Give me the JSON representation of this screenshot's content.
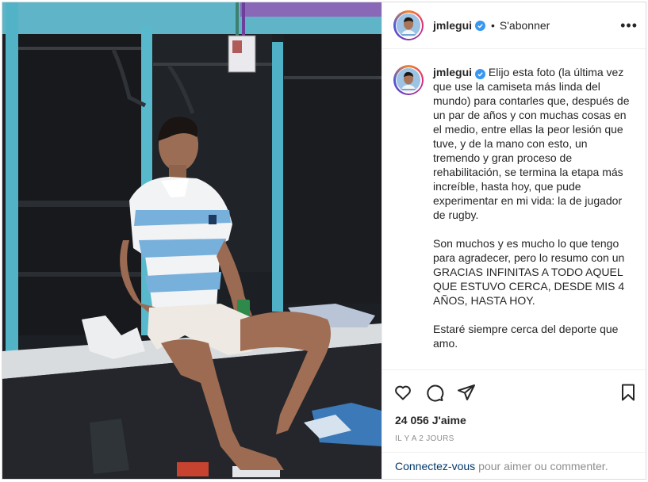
{
  "post": {
    "username": "jmlegui",
    "verified": true,
    "separator": "•",
    "follow_label": "S'abonner",
    "more_label": "•••",
    "caption": "Elijo esta foto (la última vez que use la camiseta más linda del mundo) para contarles que, después de un par de años y con muchas cosas en el medio, entre ellas la peor lesión que tuve, y de la mano con esto, un tremendo y gran proceso de rehabilitación, se termina la etapa más increíble, hasta hoy, que pude experimentar en mi vida: la de jugador de rugby.\n\nSon muchos y es mucho lo que tengo para agradecer, pero lo resumo con un GRACIAS INFINITAS A TODO AQUEL QUE ESTUVO CERCA, DESDE MIS 4 AÑOS, HASTA HOY.\n\nEstaré siempre cerca del deporte que amo.",
    "likes": "24 056 J'aime",
    "timestamp": "IL Y A 2 JOURS",
    "login_link": "Connectez-vous",
    "login_suffix": "pour aimer ou commenter."
  },
  "icons": {
    "like": "heart-icon",
    "comment": "comment-icon",
    "share": "paper-plane-icon",
    "save": "bookmark-icon",
    "verified": "verified-badge-icon",
    "more": "more-options-icon"
  },
  "colors": {
    "verified_blue": "#3897f0",
    "link_blue": "#00376b",
    "muted_gray": "#8e8e8e",
    "jersey_blue": "#75aedb",
    "locker_teal": "#4fb0c6"
  }
}
